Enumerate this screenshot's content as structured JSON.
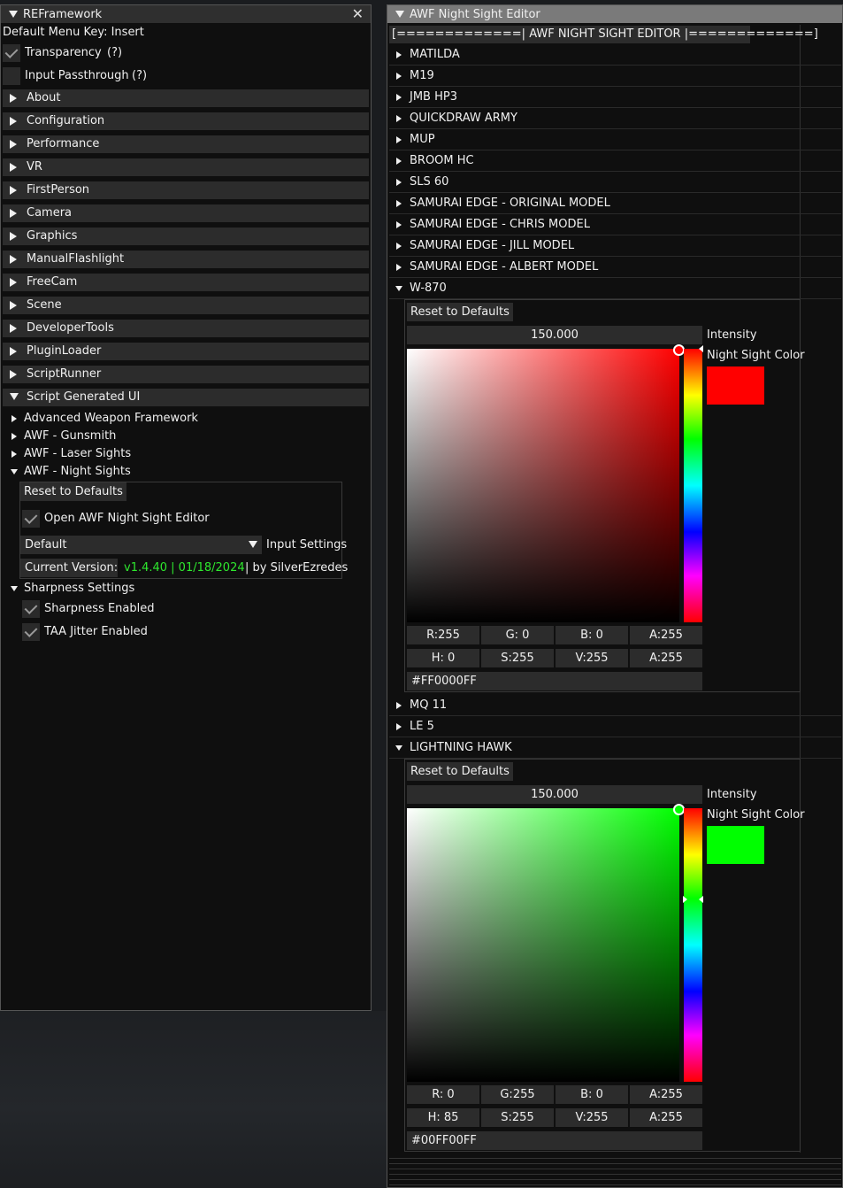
{
  "left_window": {
    "title": "REFramework",
    "menu_key": "Default Menu Key: Insert",
    "transparency_label": "Transparency",
    "input_passthrough_label": "Input Passthrough",
    "help_marker": "(?)",
    "sections": [
      "About",
      "Configuration",
      "Performance",
      "VR",
      "FirstPerson",
      "Camera",
      "Graphics",
      "ManualFlashlight",
      "FreeCam",
      "Scene",
      "DeveloperTools",
      "PluginLoader",
      "ScriptRunner",
      "Script Generated UI"
    ],
    "script_nodes": [
      "Advanced Weapon Framework",
      "AWF - Gunsmith",
      "AWF - Laser Sights",
      "AWF - Night Sights"
    ],
    "reset_label": "Reset to Defaults",
    "open_editor_label": "Open AWF Night Sight Editor",
    "preset_value": "Default",
    "input_settings_label": "Input Settings",
    "version_label": "Current Version:",
    "version_value": "v1.4.40 | 01/18/2024",
    "author": "| by SilverEzredes",
    "sharpness_node": "Sharpness Settings",
    "sharpness_enabled_label": "Sharpness Enabled",
    "taa_label": "TAA Jitter Enabled"
  },
  "right_window": {
    "title": "AWF Night Sight Editor",
    "banner": "[=============| AWF NIGHT SIGHT EDITOR |=============]",
    "weapons_top": [
      "MATILDA",
      "M19",
      "JMB HP3",
      "QUICKDRAW ARMY",
      "MUP",
      "BROOM HC",
      "SLS 60",
      "SAMURAI EDGE - ORIGINAL MODEL",
      "SAMURAI EDGE - CHRIS MODEL",
      "SAMURAI EDGE - JILL MODEL",
      "SAMURAI EDGE - ALBERT MODEL"
    ],
    "w870": {
      "label": "W-870",
      "reset_label": "Reset to Defaults",
      "intensity_value": "150.000",
      "intensity_label": "Intensity",
      "color_label": "Night Sight Color",
      "color": "#FF0000",
      "rgb": [
        "R:255",
        "G: 0",
        "B: 0",
        "A:255"
      ],
      "hsv": [
        "H: 0",
        "S:255",
        "V:255",
        "A:255"
      ],
      "hex": "#FF0000FF"
    },
    "weapons_mid": [
      "MQ 11",
      "LE 5"
    ],
    "lightning_hawk": {
      "label": "LIGHTNING HAWK",
      "reset_label": "Reset to Defaults",
      "intensity_value": "150.000",
      "intensity_label": "Intensity",
      "color_label": "Night Sight Color",
      "color": "#00FF00",
      "rgb": [
        "R: 0",
        "G:255",
        "B: 0",
        "A:255"
      ],
      "hsv": [
        "H: 85",
        "S:255",
        "V:255",
        "A:255"
      ],
      "hex": "#00FF00FF"
    }
  }
}
